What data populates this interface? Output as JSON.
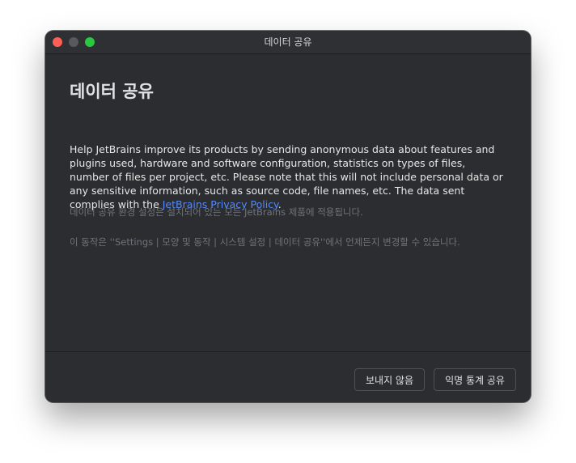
{
  "window": {
    "title": "데이터 공유"
  },
  "dialog": {
    "heading": "데이터 공유",
    "description_prefix": "Help JetBrains improve its products by sending anonymous data about features and plugins used, hardware and software configuration, statistics on types of files, number of files per project, etc. Please note that this will not include personal data or any sensitive information, such as source code, file names, etc. The data sent complies with the ",
    "privacy_link": "JetBrains Privacy Policy",
    "description_suffix": ".",
    "note_all_products": "데이터 공유 환경 설정은 설치되어 있는 모든 JetBrains 제품에 적용됩니다.",
    "note_change_location": "이 동작은 ''Settings | 모양 및 동작 | 시스템 설정 | 데이터 공유''에서 언제든지 변경할 수 있습니다."
  },
  "footer": {
    "dont_send_label": "보내지 않음",
    "share_label": "익명 통계 공유"
  },
  "colors": {
    "background": "#2b2d30",
    "link": "#548af7",
    "close": "#fe5f57",
    "maximize": "#28c840"
  }
}
